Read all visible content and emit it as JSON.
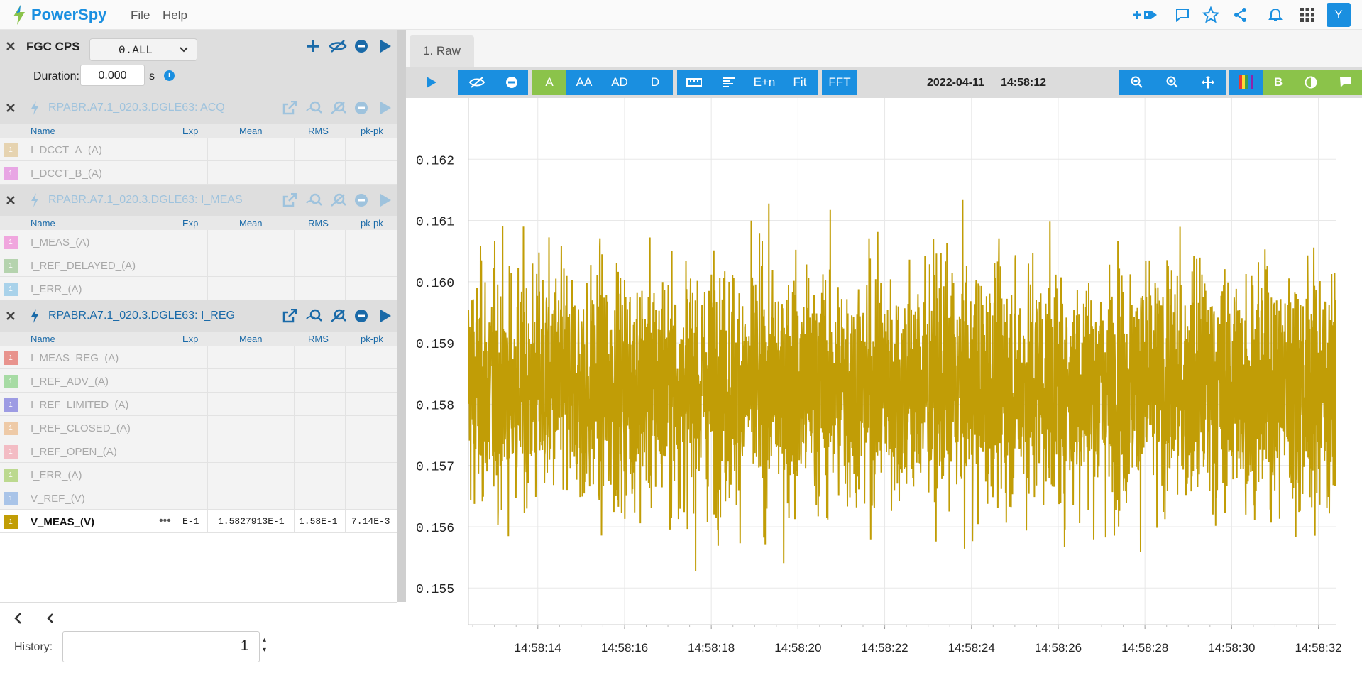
{
  "app": {
    "name": "PowerSpy",
    "menu": [
      "File",
      "Help"
    ],
    "avatar": "Y"
  },
  "left": {
    "group_title": "FGC CPS",
    "select_value": "0.ALL",
    "duration_label": "Duration:",
    "duration_value": "0.000",
    "duration_unit": "s",
    "columns": [
      "Name",
      "Exp",
      "Mean",
      "RMS",
      "pk-pk"
    ],
    "devices": [
      {
        "title": "RPABR.A7.1_020.3.DGLE63: ACQ",
        "active": false,
        "signals": [
          {
            "name": "I_DCCT_A_(A)",
            "color": "#e6d3b0"
          },
          {
            "name": "I_DCCT_B_(A)",
            "color": "#e8a6e4"
          }
        ]
      },
      {
        "title": "RPABR.A7.1_020.3.DGLE63: I_MEAS",
        "active": false,
        "signals": [
          {
            "name": "I_MEAS_(A)",
            "color": "#f0a6de"
          },
          {
            "name": "I_REF_DELAYED_(A)",
            "color": "#b5d3ae"
          },
          {
            "name": "I_ERR_(A)",
            "color": "#a9d2ea"
          }
        ]
      },
      {
        "title": "RPABR.A7.1_020.3.DGLE63: I_REG",
        "active": true,
        "signals": [
          {
            "name": "I_MEAS_REG_(A)",
            "color": "#e8938d"
          },
          {
            "name": "I_REF_ADV_(A)",
            "color": "#a7dba4"
          },
          {
            "name": "I_REF_LIMITED_(A)",
            "color": "#9d9be3"
          },
          {
            "name": "I_REF_CLOSED_(A)",
            "color": "#eecaa7"
          },
          {
            "name": "I_REF_OPEN_(A)",
            "color": "#f3bcc4"
          },
          {
            "name": "I_ERR_(A)",
            "color": "#bcd98f"
          },
          {
            "name": "V_REF_(V)",
            "color": "#a9c4e8"
          },
          {
            "name": "V_MEAS_(V)",
            "color": "#c19d06",
            "exp": "E-1",
            "mean": "1.5827913E-1",
            "rms": "1.58E-1",
            "pkpk": "7.14E-3"
          }
        ]
      }
    ],
    "history_label": "History:",
    "history_value": "1"
  },
  "chart_panel": {
    "tab": "1. Raw",
    "toolbar": {
      "a": "A",
      "aa": "AA",
      "ad": "AD",
      "d": "D",
      "en": "E+n",
      "fit": "Fit",
      "fft": "FFT",
      "b": "B"
    },
    "date": "2022-04-11",
    "time": "14:58:12"
  },
  "chart_data": {
    "type": "line",
    "series": [
      {
        "name": "V_MEAS_(V)",
        "color": "#c19d06"
      }
    ],
    "x_ticks": [
      "14:58:14",
      "14:58:16",
      "14:58:18",
      "14:58:20",
      "14:58:22",
      "14:58:24",
      "14:58:26",
      "14:58:28",
      "14:58:30",
      "14:58:32"
    ],
    "y_ticks": [
      "0.162",
      "0.161",
      "0.160",
      "0.159",
      "0.158",
      "0.157",
      "0.156",
      "0.155"
    ],
    "ylim": [
      0.1544,
      0.163
    ],
    "x_range_s": [
      12.4,
      32.4
    ],
    "mean": 0.15828,
    "pk_pk": 0.00714,
    "grid": true
  }
}
